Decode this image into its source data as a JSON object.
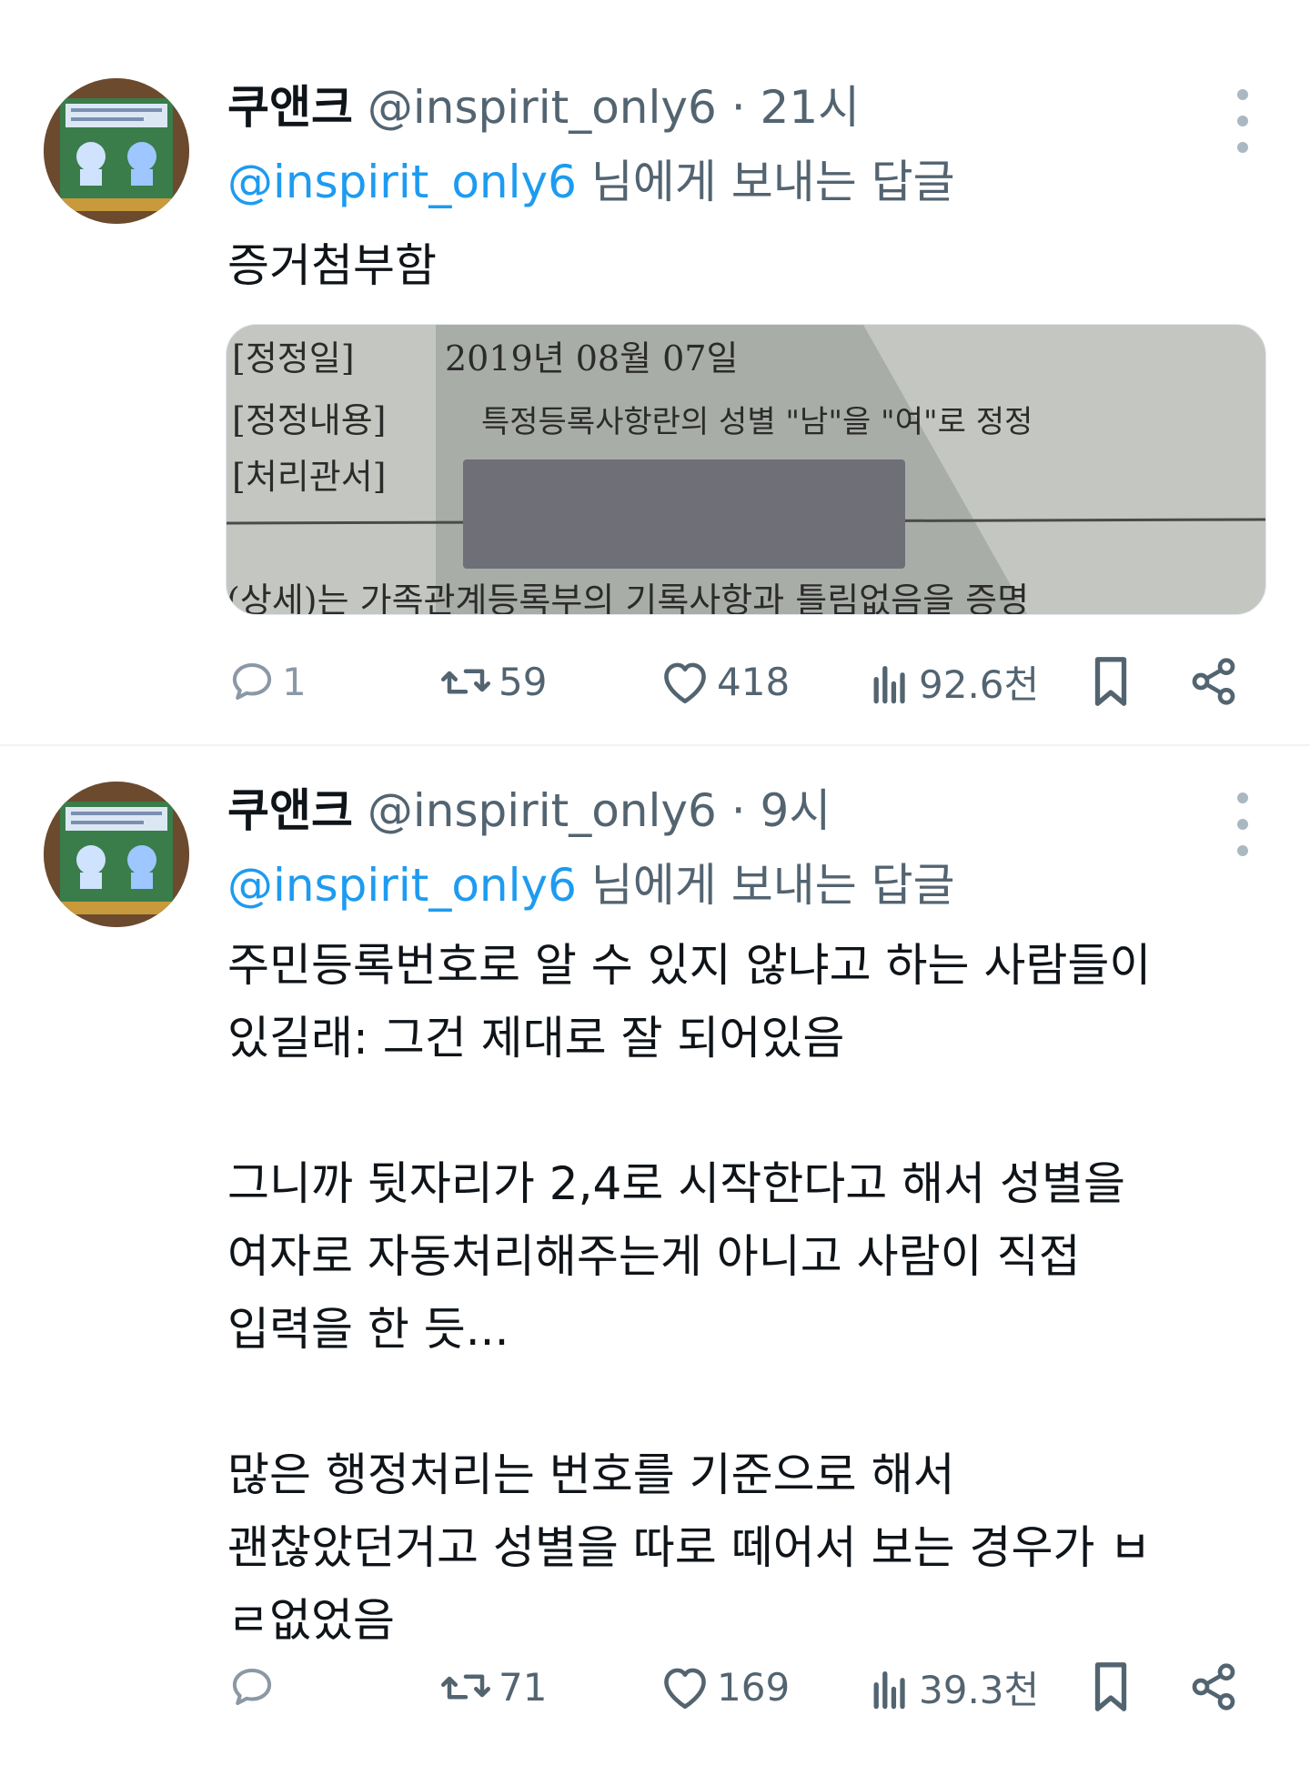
{
  "tweets": [
    {
      "author": {
        "name": "쿠앤크",
        "handle": "@inspirit_only6",
        "separator": "·",
        "time": "21시"
      },
      "reply_to": {
        "mention": "@inspirit_only6",
        "suffix": "님에게 보내는 답글"
      },
      "text": "증거첨부함",
      "media": {
        "doc_lines": [
          {
            "label": "[정정일]",
            "value": "2019년 08월 07일"
          },
          {
            "label": "[정정내용]",
            "value": "특정등록사항란의 성별 \"남\"을 \"여\"로 정정"
          },
          {
            "label": "[처리관서]",
            "value": ""
          }
        ],
        "doc_footer": "(상세)는 가족관계등록부의 기록사항과 틀림없음을 증명"
      },
      "actions": {
        "replies": "1",
        "reposts": "59",
        "likes": "418",
        "views": "92.6천"
      }
    },
    {
      "author": {
        "name": "쿠앤크",
        "handle": "@inspirit_only6",
        "separator": "·",
        "time": "9시"
      },
      "reply_to": {
        "mention": "@inspirit_only6",
        "suffix": "님에게 보내는 답글"
      },
      "text": "주민등록번호로 알 수 있지 않냐고 하는 사람들이\n있길래: 그건 제대로 잘 되어있음\n\n그니까 뒷자리가 2,4로 시작한다고 해서 성별을\n여자로 자동처리해주는게 아니고 사람이 직접\n입력을 한 듯...\n\n많은 행정처리는 번호를 기준으로 해서\n괜찮았던거고 성별을 따로 떼어서 보는 경우가 ㅂ\nㄹ없었음",
      "actions": {
        "replies": "",
        "reposts": "71",
        "likes": "169",
        "views": "39.3천"
      }
    }
  ],
  "icons": [
    "more-icon",
    "reply-icon",
    "repost-icon",
    "like-icon",
    "views-icon",
    "bookmark-icon",
    "share-icon"
  ],
  "colors": {
    "accent": "#1d9bf0",
    "secondary_text": "#536471",
    "primary_text": "#0f1419",
    "divider": "#eff3f4"
  }
}
